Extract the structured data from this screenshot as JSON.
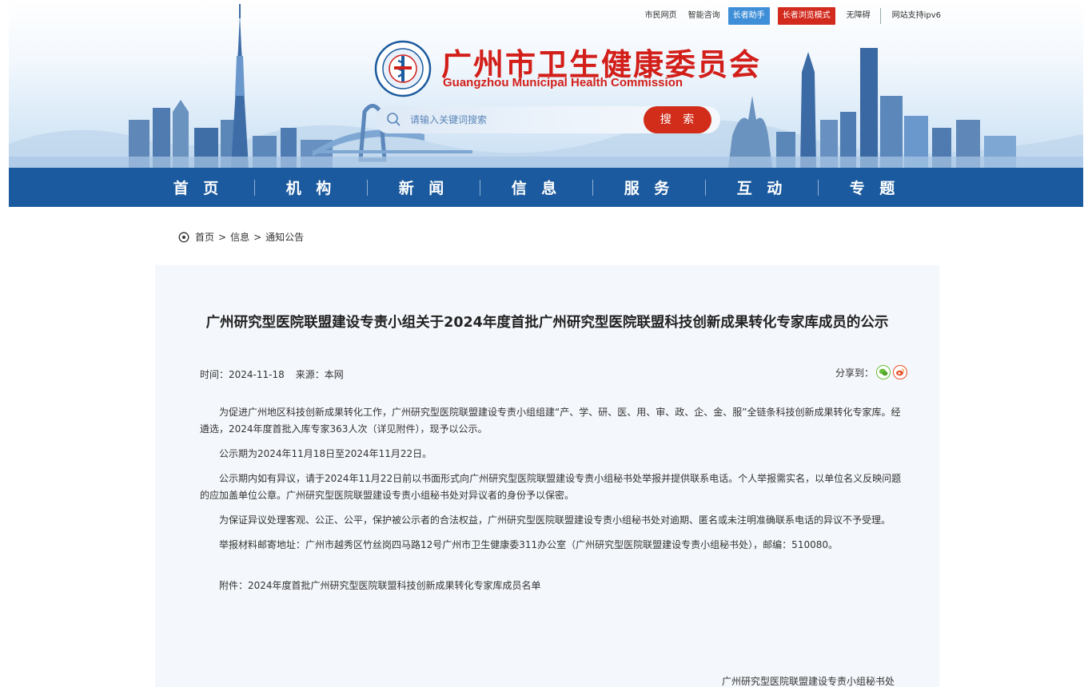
{
  "toplinks": [
    {
      "label": "市民网页",
      "style": "plain"
    },
    {
      "label": "智能咨询",
      "style": "plain"
    },
    {
      "label": "长者助手",
      "style": "blue"
    },
    {
      "label": "长者浏览模式",
      "style": "red"
    },
    {
      "label": "无障碍",
      "style": "plain"
    },
    {
      "label": "网站支持ipv6",
      "style": "plain"
    }
  ],
  "header": {
    "title_cn": "广州市卫生健康委员会",
    "title_en": "Guangzhou Municipal Health Commission"
  },
  "search": {
    "placeholder": "请输入关键词搜索",
    "button_label": "搜 索"
  },
  "nav": [
    "首 页",
    "机 构",
    "新 闻",
    "信 息",
    "服 务",
    "互 动",
    "专 题"
  ],
  "breadcrumb": [
    "首页",
    "信息",
    "通知公告"
  ],
  "article": {
    "title": "广州研究型医院联盟建设专责小组关于2024年度首批广州研究型医院联盟科技创新成果转化专家库成员的公示",
    "time": "时间：2024-11-18",
    "source": "来源：本网",
    "share_label": "分享到：",
    "paragraphs": [
      "为促进广州地区科技创新成果转化工作，广州研究型医院联盟建设专责小组组建“产、学、研、医、用、审、政、企、金、服”全链条科技创新成果转化专家库。经遴选，2024年度首批入库专家363人次（详见附件），现予以公示。",
      "公示期为2024年11月18日至2024年11月22日。",
      "公示期内如有异议，请于2024年11月22日前以书面形式向广州研究型医院联盟建设专责小组秘书处举报并提供联系电话。个人举报需实名，以单位名义反映问题的应加盖单位公章。广州研究型医院联盟建设专责小组秘书处对异议者的身份予以保密。",
      "为保证异议处理客观、公正、公平，保护被公示者的合法权益，广州研究型医院联盟建设专责小组秘书处对逾期、匿名或未注明准确联系电话的异议不予受理。",
      "举报材料邮寄地址：广州市越秀区竹丝岗四马路12号广州市卫生健康委311办公室（广州研究型医院联盟建设专责小组秘书处），邮编：510080。"
    ],
    "attachment": "附件：2024年度首批广州研究型医院联盟科技创新成果转化专家库成员名单",
    "signature": "广州研究型医院联盟建设专责小组秘书处"
  },
  "colors": {
    "brand_red": "#d31f1a",
    "nav_blue": "#1b5a9e",
    "button_blue": "#3f8fd8"
  }
}
